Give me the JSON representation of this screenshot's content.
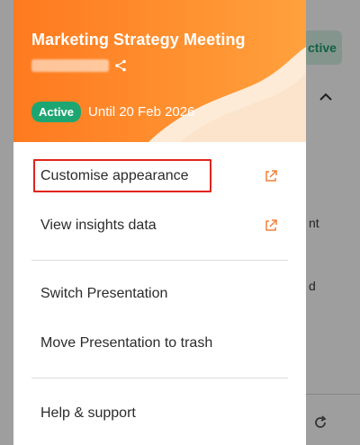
{
  "background": {
    "status_label": "ctive",
    "text1": "nt",
    "text2": "d"
  },
  "panel": {
    "title": "Marketing Strategy Meeting",
    "status_badge": "Active",
    "until_text": "Until 20 Feb 2026",
    "colors": {
      "header_orange": "#ff8c2a",
      "badge_green": "#1ea672",
      "highlight_red": "#e0241b"
    }
  },
  "menu": {
    "customise_appearance": "Customise appearance",
    "view_insights": "View insights data",
    "switch_presentation": "Switch Presentation",
    "move_to_trash": "Move Presentation to trash",
    "help_support": "Help & support"
  },
  "icons": {
    "external_link": "external-link-icon",
    "share": "share-icon",
    "chevron": "chevron-up-icon",
    "refresh": "refresh-icon"
  }
}
